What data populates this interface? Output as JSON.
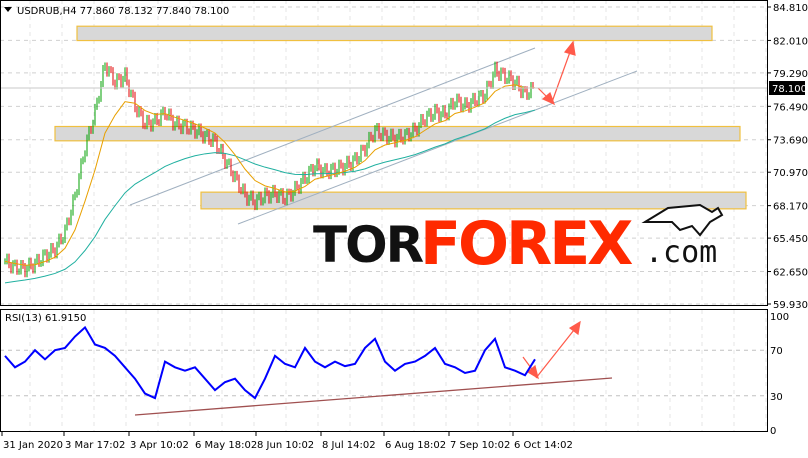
{
  "header": {
    "symbol": "USDRUB,H4",
    "ohlc": "77.860 78.132 77.840 78.100"
  },
  "rsi_header": {
    "label": "RSI(13) 61.9150"
  },
  "logo": {
    "text_black": "TOR",
    "text_red": "FOREX",
    "text_com": ".com"
  },
  "colors": {
    "bull": "#00a000",
    "bear": "#e00000",
    "ma_fast": "#e8a000",
    "ma_slow": "#20b0a0",
    "rsi": "#0000ff",
    "zone": "#d8d8d8",
    "zone_border": "#f0c040",
    "arrow": "#ff5a4a",
    "trend": "#a0b0c0",
    "rsi_trend": "#a05050",
    "logo_red": "#ff2a00"
  },
  "chart_data": [
    {
      "type": "candlestick",
      "title": "USDRUB,H4",
      "ylim": [
        59.93,
        84.81
      ],
      "yticks": [
        "84.810",
        "82.010",
        "79.290",
        "76.490",
        "73.690",
        "70.970",
        "68.170",
        "65.450",
        "62.650",
        "59.930"
      ],
      "ytick_values": [
        84.81,
        82.01,
        79.29,
        76.49,
        73.69,
        70.97,
        68.17,
        65.45,
        62.65,
        59.93
      ],
      "current_price": "78.100",
      "xticks": [
        "31 Jan 2020",
        "3 Mar 17:02",
        "3 Apr 10:02",
        "6 May 18:02",
        "8 Jun 10:02",
        "8 Jul 14:02",
        "6 Aug 18:02",
        "7 Sep 10:02",
        "6 Oct 14:02"
      ],
      "close": [
        63.5,
        63,
        62.9,
        63.3,
        64,
        64.5,
        66,
        69,
        73,
        76,
        80,
        78.5,
        79,
        76.5,
        75,
        75.2,
        76,
        75,
        74.8,
        74.5,
        74,
        73.5,
        72,
        70.5,
        69,
        68.5,
        69,
        69.2,
        68.8,
        69.5,
        70.5,
        71.5,
        71,
        71.2,
        71.5,
        72,
        73,
        74.5,
        74,
        73.8,
        74,
        74.5,
        75.5,
        76,
        75.8,
        77,
        76.5,
        77,
        77.5,
        79.5,
        79,
        78.5,
        77.5,
        78.1
      ],
      "zones": [
        [
          82.0,
          83.2
        ],
        [
          73.6,
          74.8
        ],
        [
          67.9,
          69.3
        ]
      ]
    },
    {
      "type": "line",
      "title": "RSI(13) 61.9150",
      "ylim": [
        0,
        100
      ],
      "yticks": [
        "100",
        "70",
        "30",
        "0"
      ],
      "ytick_values": [
        100,
        70,
        30,
        0
      ],
      "values": [
        65,
        55,
        60,
        70,
        62,
        70,
        72,
        82,
        90,
        75,
        72,
        65,
        55,
        45,
        32,
        28,
        60,
        55,
        52,
        55,
        45,
        35,
        42,
        45,
        35,
        28,
        45,
        65,
        58,
        55,
        72,
        60,
        55,
        60,
        56,
        58,
        72,
        80,
        60,
        52,
        58,
        60,
        65,
        72,
        58,
        55,
        50,
        52,
        70,
        80,
        55,
        52,
        48,
        62
      ]
    }
  ]
}
